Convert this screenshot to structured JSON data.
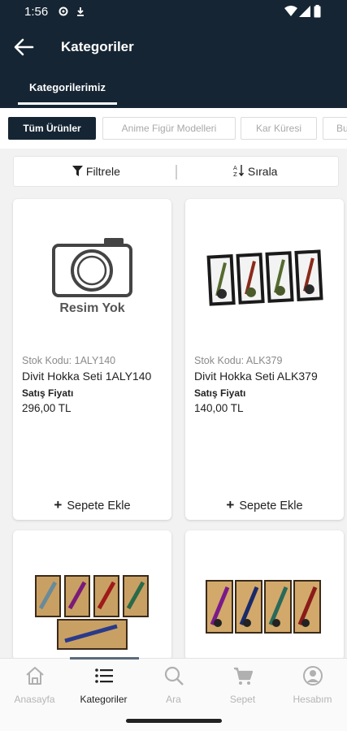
{
  "status_bar": {
    "time": "1:56"
  },
  "app_bar": {
    "title": "Kategoriler",
    "tab": "Kategorilerimiz"
  },
  "categories": [
    {
      "label": "Tüm Ürünler",
      "active": true
    },
    {
      "label": "Anime Figür Modelleri",
      "active": false
    },
    {
      "label": "Kar Küresi",
      "active": false
    },
    {
      "label": "Bu",
      "active": false
    }
  ],
  "filter_bar": {
    "filter_label": "Filtrele",
    "sort_label": "Sırala"
  },
  "products": [
    {
      "stock_code": "Stok Kodu: 1ALY140",
      "name": "Divit Hokka Seti 1ALY140",
      "price_label": "Satış Fiyatı",
      "price": "296,00 TL",
      "add_label": "Sepete Ekle",
      "no_image_text": "Resim Yok"
    },
    {
      "stock_code": "Stok Kodu: ALK379",
      "name": "Divit Hokka Seti ALK379",
      "price_label": "Satış Fiyatı",
      "price": "140,00 TL",
      "add_label": "Sepete Ekle"
    },
    {},
    {}
  ],
  "bottom_nav": [
    {
      "label": "Anasayfa",
      "icon": "home-icon",
      "active": false
    },
    {
      "label": "Kategoriler",
      "icon": "list-icon",
      "active": true
    },
    {
      "label": "Ara",
      "icon": "search-icon",
      "active": false
    },
    {
      "label": "Sepet",
      "icon": "cart-icon",
      "active": false
    },
    {
      "label": "Hesabım",
      "icon": "account-icon",
      "active": false
    }
  ],
  "colors": {
    "primary_dark": "#152533",
    "background": "#f2f2f2",
    "card": "#ffffff",
    "muted_text": "#8a8a8a"
  }
}
